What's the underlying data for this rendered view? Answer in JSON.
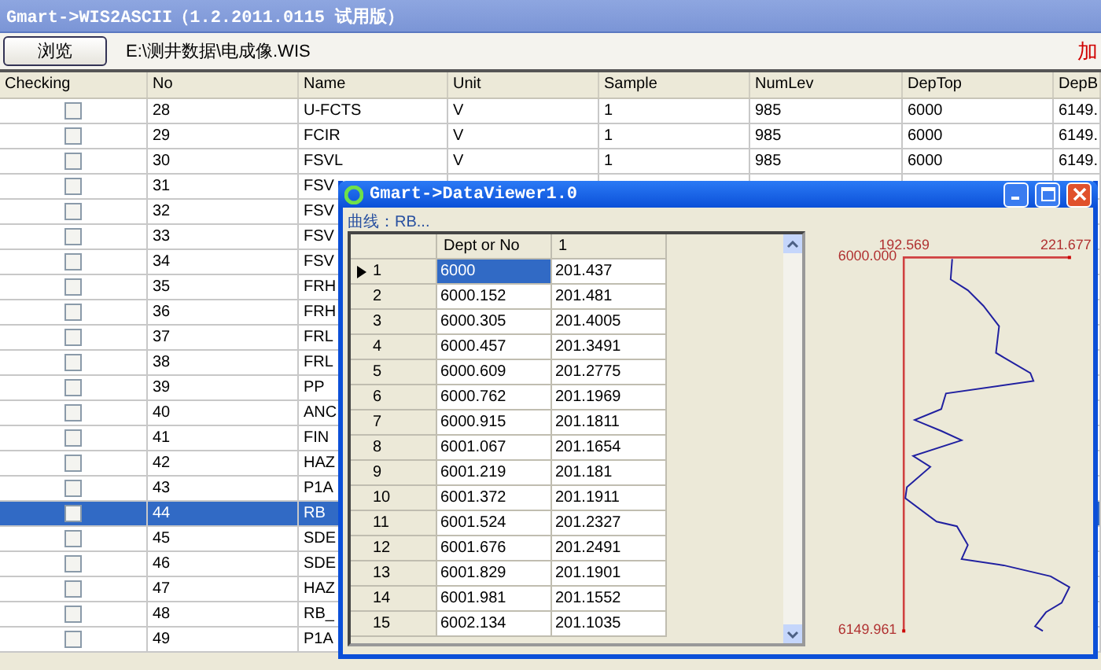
{
  "window": {
    "title": "Gmart->WIS2ASCII（1.2.2011.0115 试用版）"
  },
  "toolbar": {
    "browse_button": "浏览",
    "file_path": "E:\\测井数据\\电成像.WIS",
    "load_label": "加"
  },
  "table": {
    "check_column": "Checking",
    "columns": [
      "No",
      "Name",
      "Unit",
      "Sample",
      "NumLev",
      "DepTop",
      "DepB"
    ],
    "rows": [
      {
        "checked": false,
        "selected": false,
        "cells": [
          "28",
          "U-FCTS",
          "V",
          "1",
          "985",
          "6000",
          "6149."
        ]
      },
      {
        "checked": false,
        "selected": false,
        "cells": [
          "29",
          "FCIR",
          "V",
          "1",
          "985",
          "6000",
          "6149."
        ]
      },
      {
        "checked": false,
        "selected": false,
        "cells": [
          "30",
          "FSVL",
          "V",
          "1",
          "985",
          "6000",
          "6149."
        ]
      },
      {
        "checked": false,
        "selected": false,
        "cells": [
          "31",
          "FSV"
        ]
      },
      {
        "checked": false,
        "selected": false,
        "cells": [
          "32",
          "FSV"
        ]
      },
      {
        "checked": false,
        "selected": false,
        "cells": [
          "33",
          "FSV"
        ]
      },
      {
        "checked": false,
        "selected": false,
        "cells": [
          "34",
          "FSV"
        ]
      },
      {
        "checked": false,
        "selected": false,
        "cells": [
          "35",
          "FRH"
        ]
      },
      {
        "checked": false,
        "selected": false,
        "cells": [
          "36",
          "FRH"
        ]
      },
      {
        "checked": false,
        "selected": false,
        "cells": [
          "37",
          "FRL"
        ]
      },
      {
        "checked": false,
        "selected": false,
        "cells": [
          "38",
          "FRL"
        ]
      },
      {
        "checked": false,
        "selected": false,
        "cells": [
          "39",
          "PP"
        ]
      },
      {
        "checked": false,
        "selected": false,
        "cells": [
          "40",
          "ANC"
        ]
      },
      {
        "checked": false,
        "selected": false,
        "cells": [
          "41",
          "FIN"
        ]
      },
      {
        "checked": false,
        "selected": false,
        "cells": [
          "42",
          "HAZ"
        ]
      },
      {
        "checked": false,
        "selected": false,
        "cells": [
          "43",
          "P1A"
        ]
      },
      {
        "checked": false,
        "selected": true,
        "cells": [
          "44",
          "RB"
        ]
      },
      {
        "checked": false,
        "selected": false,
        "cells": [
          "45",
          "SDE"
        ]
      },
      {
        "checked": false,
        "selected": false,
        "cells": [
          "46",
          "SDE"
        ]
      },
      {
        "checked": false,
        "selected": false,
        "cells": [
          "47",
          "HAZ"
        ]
      },
      {
        "checked": false,
        "selected": false,
        "cells": [
          "48",
          "RB_"
        ]
      },
      {
        "checked": false,
        "selected": false,
        "cells": [
          "49",
          "P1A"
        ]
      }
    ]
  },
  "dialog": {
    "title": "Gmart->DataViewer1.0",
    "curve_label": "曲线：RB...",
    "grid": {
      "columns": [
        "Dept or No",
        "1"
      ],
      "rows": [
        {
          "label": "1",
          "current": true,
          "cells": [
            {
              "text": "6000",
              "selected": true
            },
            {
              "text": "201.437",
              "selected": false
            }
          ]
        },
        {
          "label": "2",
          "current": false,
          "cells": [
            {
              "text": "6000.152",
              "selected": false
            },
            {
              "text": "201.481",
              "selected": false
            }
          ]
        },
        {
          "label": "3",
          "current": false,
          "cells": [
            {
              "text": "6000.305",
              "selected": false
            },
            {
              "text": "201.4005",
              "selected": false
            }
          ]
        },
        {
          "label": "4",
          "current": false,
          "cells": [
            {
              "text": "6000.457",
              "selected": false
            },
            {
              "text": "201.3491",
              "selected": false
            }
          ]
        },
        {
          "label": "5",
          "current": false,
          "cells": [
            {
              "text": "6000.609",
              "selected": false
            },
            {
              "text": "201.2775",
              "selected": false
            }
          ]
        },
        {
          "label": "6",
          "current": false,
          "cells": [
            {
              "text": "6000.762",
              "selected": false
            },
            {
              "text": "201.1969",
              "selected": false
            }
          ]
        },
        {
          "label": "7",
          "current": false,
          "cells": [
            {
              "text": "6000.915",
              "selected": false
            },
            {
              "text": "201.1811",
              "selected": false
            }
          ]
        },
        {
          "label": "8",
          "current": false,
          "cells": [
            {
              "text": "6001.067",
              "selected": false
            },
            {
              "text": "201.1654",
              "selected": false
            }
          ]
        },
        {
          "label": "9",
          "current": false,
          "cells": [
            {
              "text": "6001.219",
              "selected": false
            },
            {
              "text": "201.181",
              "selected": false
            }
          ]
        },
        {
          "label": "10",
          "current": false,
          "cells": [
            {
              "text": "6001.372",
              "selected": false
            },
            {
              "text": "201.1911",
              "selected": false
            }
          ]
        },
        {
          "label": "11",
          "current": false,
          "cells": [
            {
              "text": "6001.524",
              "selected": false
            },
            {
              "text": "201.2327",
              "selected": false
            }
          ]
        },
        {
          "label": "12",
          "current": false,
          "cells": [
            {
              "text": "6001.676",
              "selected": false
            },
            {
              "text": "201.2491",
              "selected": false
            }
          ]
        },
        {
          "label": "13",
          "current": false,
          "cells": [
            {
              "text": "6001.829",
              "selected": false
            },
            {
              "text": "201.1901",
              "selected": false
            }
          ]
        },
        {
          "label": "14",
          "current": false,
          "cells": [
            {
              "text": "6001.981",
              "selected": false
            },
            {
              "text": "201.1552",
              "selected": false
            }
          ]
        },
        {
          "label": "15",
          "current": false,
          "cells": [
            {
              "text": "6002.134",
              "selected": false
            },
            {
              "text": "201.1035",
              "selected": false
            }
          ]
        }
      ]
    },
    "plot": {
      "x_min": "192.569",
      "x_max": "221.677",
      "top_depth": "6000.000",
      "bottom_depth": "6149.961"
    }
  }
}
